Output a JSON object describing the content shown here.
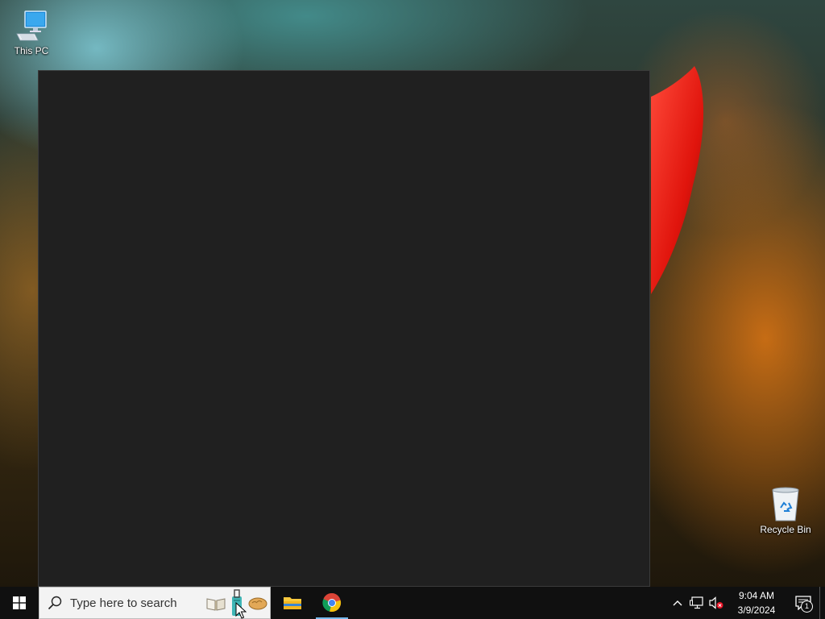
{
  "desktop": {
    "icons": [
      {
        "label": "This PC",
        "icon": "this-pc-icon"
      },
      {
        "label": "Recycle Bin",
        "icon": "recycle-bin-icon"
      }
    ]
  },
  "window": {
    "theme_color": "#202020"
  },
  "taskbar": {
    "start_icon": "windows-logo-icon",
    "search": {
      "placeholder": "Type here to search",
      "icon": "search-icon",
      "highlights": [
        "book-icon",
        "suitcase-icon",
        "bread-icon"
      ]
    },
    "pinned": [
      {
        "name": "File Explorer",
        "icon": "folder-icon",
        "active": false
      },
      {
        "name": "Google Chrome",
        "icon": "chrome-icon",
        "active": true
      }
    ],
    "tray": {
      "icons": [
        "chevron-up-icon",
        "network-icon",
        "volume-muted-icon"
      ],
      "time": "9:04 AM",
      "date": "3/9/2024",
      "notification_count": "1"
    },
    "accent_color": "#76b9ed"
  }
}
